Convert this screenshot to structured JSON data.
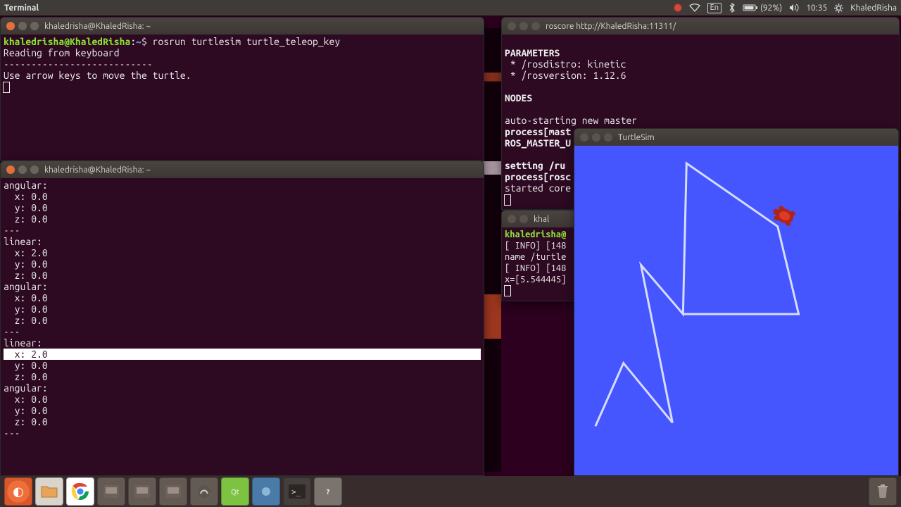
{
  "panel": {
    "app_title": "Terminal",
    "lang": "En",
    "battery": "(92%)",
    "time": "10:35",
    "user": "KhaledRisha"
  },
  "term1": {
    "title": "khaledrisha@KhaledRisha: ~",
    "prompt_user": "khaledrisha@KhaledRisha",
    "prompt_sep": ":",
    "prompt_path": "~",
    "prompt_end": "$ ",
    "cmd": "rosrun turtlesim turtle_teleop_key",
    "out1": "Reading from keyboard",
    "out2": "---------------------------",
    "out3": "Use arrow keys to move the turtle."
  },
  "term2": {
    "title": "khaledrisha@KhaledRisha: ~",
    "lines": [
      "angular:",
      "  x: 0.0",
      "  y: 0.0",
      "  z: 0.0",
      "---",
      "linear:",
      "  x: 2.0",
      "  y: 0.0",
      "  z: 0.0",
      "angular:",
      "  x: 0.0",
      "  y: 0.0",
      "  z: 0.0",
      "---",
      "linear:"
    ],
    "highlight": "  x: 2.0",
    "lines_after": [
      "  y: 0.0",
      "  z: 0.0",
      "angular:",
      "  x: 0.0",
      "  y: 0.0",
      "  z: 0.0",
      "---"
    ]
  },
  "roscore": {
    "title": "roscore http://KhaledRisha:11311/",
    "l1": "PARAMETERS",
    "l2": " * /rosdistro: kinetic",
    "l3": " * /rosversion: 1.12.6",
    "l4": "",
    "l5": "NODES",
    "l6": "",
    "l7": "auto-starting new master",
    "l8": "process[mast",
    "l9": "ROS_MASTER_U",
    "l10": "",
    "l11": "setting /ru",
    "l12": "process[rosc",
    "l13": "started core"
  },
  "term4": {
    "title": "khal",
    "prompt_user": "khaledrisha@",
    "l1": "[ INFO] [148",
    "l2": "name /turtle",
    "l3": "[ INFO] [148",
    "l4": "x=[5.544445]"
  },
  "turtlesim": {
    "title": "TurtleSim"
  },
  "launcher": {
    "items": [
      "ubuntu",
      "files",
      "chrome",
      "app1",
      "app2",
      "app3",
      "app4",
      "qt",
      "app5",
      "term",
      "help"
    ]
  }
}
